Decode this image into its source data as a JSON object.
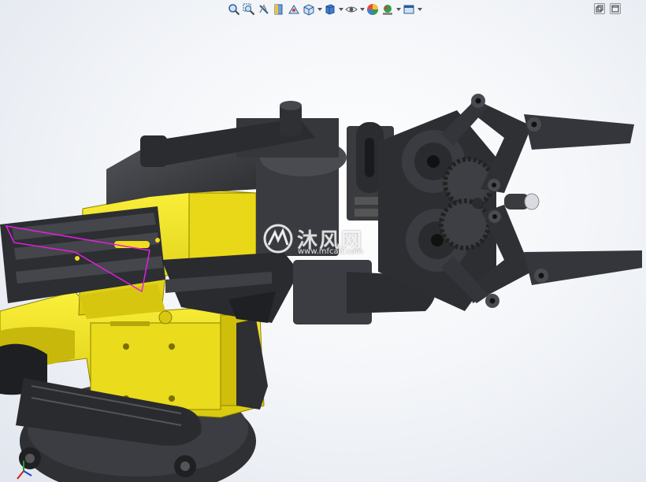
{
  "app": "SolidWorks",
  "heads_up_toolbar": {
    "items": [
      {
        "name": "zoom-to-fit-icon",
        "dropdown": false
      },
      {
        "name": "zoom-to-area-icon",
        "dropdown": false
      },
      {
        "name": "previous-view-icon",
        "dropdown": false
      },
      {
        "name": "section-view-icon",
        "dropdown": false
      },
      {
        "name": "dynamic-annotation-icon",
        "dropdown": false
      },
      {
        "name": "view-orientation-icon",
        "dropdown": true
      },
      {
        "name": "display-style-icon",
        "dropdown": true
      },
      {
        "name": "hide-show-items-icon",
        "dropdown": true
      },
      {
        "name": "edit-appearance-icon",
        "dropdown": false
      },
      {
        "name": "apply-scene-icon",
        "dropdown": true
      },
      {
        "name": "view-settings-icon",
        "dropdown": true
      }
    ]
  },
  "window_controls": [
    "restore-icon",
    "maximize-icon"
  ],
  "watermark": {
    "brand": "沐风网",
    "url": "www.mfcad.com"
  },
  "colors": {
    "part_yellow": "#f2e21a",
    "part_dark": "#3a3b3f",
    "sketch_magenta": "#e020e0",
    "background": "#f4f6f9"
  }
}
